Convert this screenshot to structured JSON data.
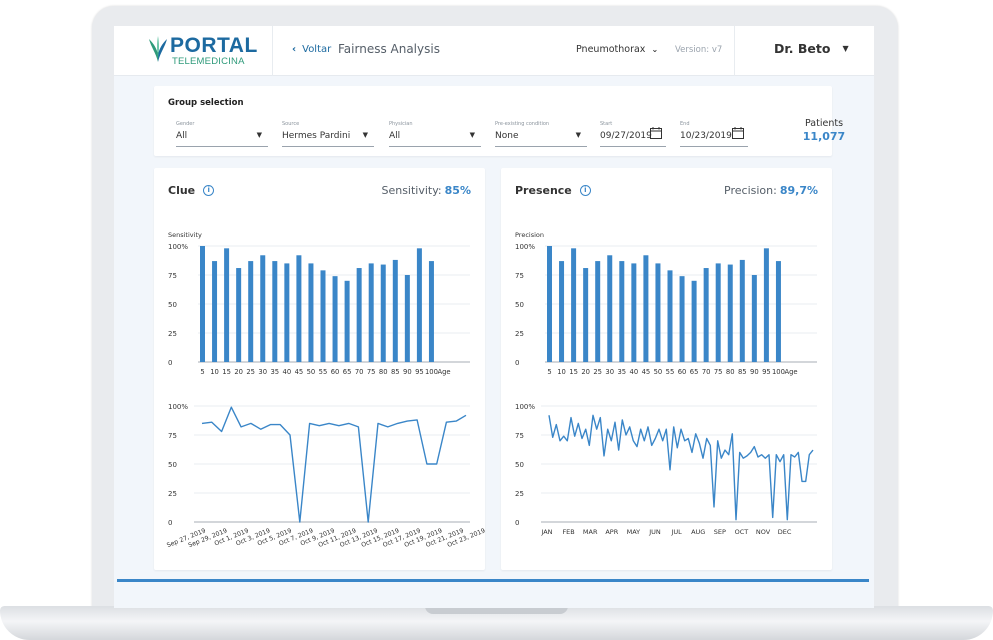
{
  "header": {
    "logo_title": "PORTAL",
    "logo_subtitle": "TELEMEDICINA",
    "back_label": "Voltar",
    "page_title": "Fairness Analysis",
    "condition": "Pneumothorax",
    "version": "Version: v7",
    "user": "Dr. Beto"
  },
  "group": {
    "title": "Group selection",
    "fields": [
      {
        "label": "Gender",
        "value": "All"
      },
      {
        "label": "Source",
        "value": "Hermes Pardini"
      },
      {
        "label": "Physician",
        "value": "All"
      },
      {
        "label": "Pre-existing condition",
        "value": "None"
      },
      {
        "label": "Start",
        "value": "09/27/2019"
      },
      {
        "label": "End",
        "value": "10/23/2019"
      }
    ],
    "patients_label": "Patients",
    "patients_value": "11,077"
  },
  "panels": {
    "clue": {
      "title": "Clue",
      "metric_label": "Sensitivity:",
      "metric_value": "85%"
    },
    "presence": {
      "title": "Presence",
      "metric_label": "Precision:",
      "metric_value": "89,7%"
    }
  },
  "colors": {
    "accent": "#3a86c8",
    "bar": "#3a86c8",
    "brand": "#1d6aa0",
    "brand_green": "#2e9a7a"
  },
  "chart_data": [
    {
      "type": "bar",
      "ylabel": "Sensitivity",
      "xlabel": "Age",
      "ylim": [
        0,
        100
      ],
      "yticks": [
        "0",
        "25",
        "50",
        "75",
        "100%"
      ],
      "categories": [
        "5",
        "10",
        "15",
        "20",
        "25",
        "30",
        "35",
        "40",
        "45",
        "50",
        "55",
        "60",
        "65",
        "70",
        "75",
        "80",
        "85",
        "90",
        "95",
        "100"
      ],
      "values": [
        100,
        87,
        98,
        81,
        87,
        92,
        87,
        85,
        92,
        85,
        79,
        74,
        70,
        81,
        85,
        84,
        88,
        75,
        98,
        87
      ],
      "grid": true
    },
    {
      "type": "line",
      "ylabel": "",
      "ylim": [
        0,
        100
      ],
      "yticks": [
        "0",
        "25",
        "50",
        "75",
        "100%"
      ],
      "categories": [
        "Sep 27, 2019",
        "Sep 29, 2019",
        "Oct 1, 2019",
        "Oct 3, 2019",
        "Oct 5, 2019",
        "Oct 7, 2019",
        "Oct 9, 2019",
        "Oct 11, 2019",
        "Oct 13, 2019",
        "Oct 15, 2019",
        "Oct 17, 2019",
        "Oct 19, 2019",
        "Oct 21, 2019",
        "Oct 23, 2019"
      ],
      "x_days": [
        0,
        1,
        2,
        3,
        4,
        5,
        6,
        7,
        8,
        9,
        10,
        11,
        12,
        13,
        14,
        15,
        16,
        17,
        18,
        19,
        20,
        21,
        22,
        23,
        24,
        25,
        26
      ],
      "values": [
        85,
        86,
        78,
        99,
        82,
        85,
        80,
        84,
        84,
        75,
        0,
        85,
        83,
        85,
        83,
        85,
        82,
        0,
        85,
        82,
        85,
        87,
        88,
        50,
        50,
        86,
        87,
        92
      ],
      "grid": true
    },
    {
      "type": "bar",
      "ylabel": "Precision",
      "xlabel": "Age",
      "ylim": [
        0,
        100
      ],
      "yticks": [
        "0",
        "25",
        "50",
        "75",
        "100%"
      ],
      "categories": [
        "5",
        "10",
        "15",
        "20",
        "25",
        "30",
        "35",
        "40",
        "45",
        "50",
        "55",
        "60",
        "65",
        "70",
        "75",
        "80",
        "85",
        "90",
        "95",
        "100"
      ],
      "values": [
        100,
        87,
        98,
        81,
        87,
        92,
        87,
        85,
        92,
        85,
        79,
        74,
        70,
        81,
        85,
        84,
        88,
        75,
        98,
        87
      ],
      "grid": true
    },
    {
      "type": "line",
      "ylabel": "",
      "ylim": [
        0,
        100
      ],
      "yticks": [
        "0",
        "25",
        "50",
        "75",
        "100%"
      ],
      "categories": [
        "JAN",
        "FEB",
        "MAR",
        "APR",
        "MAY",
        "JUN",
        "JUL",
        "AUG",
        "SEP",
        "OCT",
        "NOV",
        "DEC"
      ],
      "values": [
        92,
        73,
        84,
        70,
        74,
        70,
        90,
        74,
        85,
        72,
        80,
        66,
        92,
        80,
        90,
        57,
        80,
        70,
        86,
        62,
        88,
        75,
        82,
        70,
        65,
        80,
        70,
        82,
        66,
        72,
        80,
        70,
        80,
        45,
        82,
        64,
        80,
        70,
        72,
        60,
        76,
        68,
        55,
        72,
        66,
        13,
        70,
        55,
        62,
        58,
        76,
        2,
        60,
        55,
        57,
        60,
        65,
        56,
        58,
        55,
        58,
        4,
        58,
        52,
        58,
        2,
        58,
        56,
        60,
        35,
        35,
        58,
        62
      ],
      "grid": true
    }
  ]
}
